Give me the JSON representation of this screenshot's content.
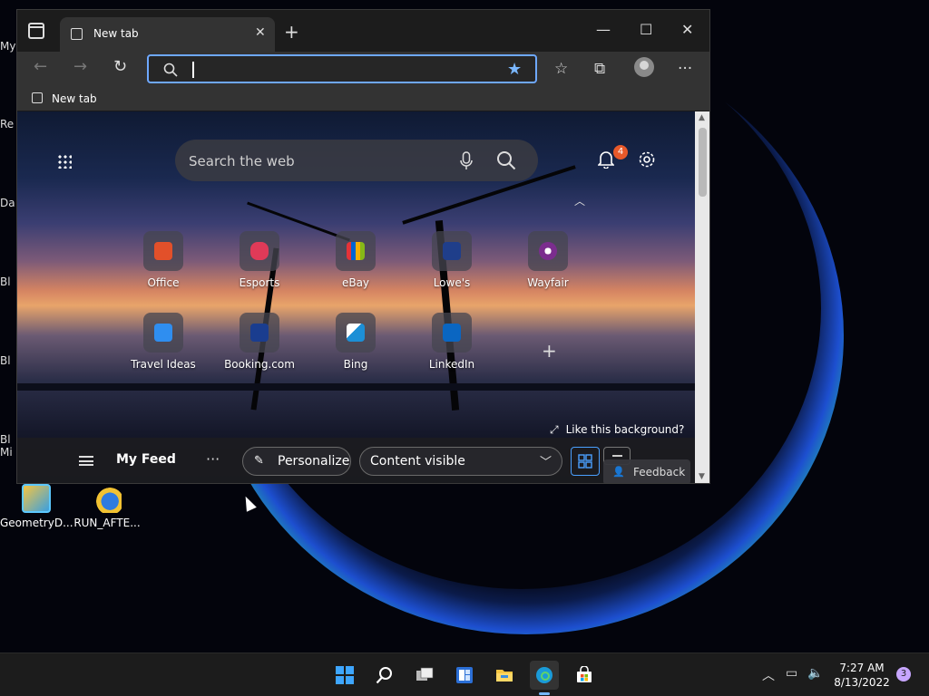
{
  "desktop": {
    "edge_labels": [
      "My",
      "Re",
      "Da",
      "Bl",
      "Bl",
      "Bl",
      "Mi"
    ],
    "icons": [
      {
        "label": "GeometryD...",
        "icon": "geometry-dash-icon"
      },
      {
        "label": "RUN_AFTE...",
        "icon": "shield-script-icon"
      }
    ]
  },
  "browser": {
    "tab": {
      "title": "New tab"
    },
    "address": {
      "value": ""
    },
    "favorites_bar": {
      "item": "New tab"
    }
  },
  "ntp": {
    "search_placeholder": "Search the web",
    "notification_count": "4",
    "quick_links": [
      {
        "label": "Office",
        "color": "#e2502a"
      },
      {
        "label": "Esports",
        "color": "#e03a58"
      },
      {
        "label": "eBay",
        "color": "#3a7be0"
      },
      {
        "label": "Lowe's",
        "color": "#1f3e8a"
      },
      {
        "label": "Wayfair",
        "color": "#7b2d8e"
      },
      {
        "label": "Travel Ideas",
        "color": "#2f8ef0"
      },
      {
        "label": "Booking.com",
        "color": "#1a3d8f"
      },
      {
        "label": "Bing",
        "color": "#1c8fd6"
      },
      {
        "label": "LinkedIn",
        "color": "#0a66c2"
      }
    ],
    "like_background": "Like this background?",
    "feed": {
      "title": "My Feed",
      "personalize": "Personalize",
      "content_option": "Content visible",
      "feedback": "Feedback"
    }
  },
  "taskbar": {
    "apps": [
      "start",
      "search",
      "task-view",
      "widgets",
      "file-explorer",
      "edge",
      "store"
    ],
    "time": "7:27 AM",
    "date": "8/13/2022",
    "notification_count": "3"
  },
  "colors": {
    "accent": "#4aa0ff",
    "badge": "#e8592a"
  }
}
